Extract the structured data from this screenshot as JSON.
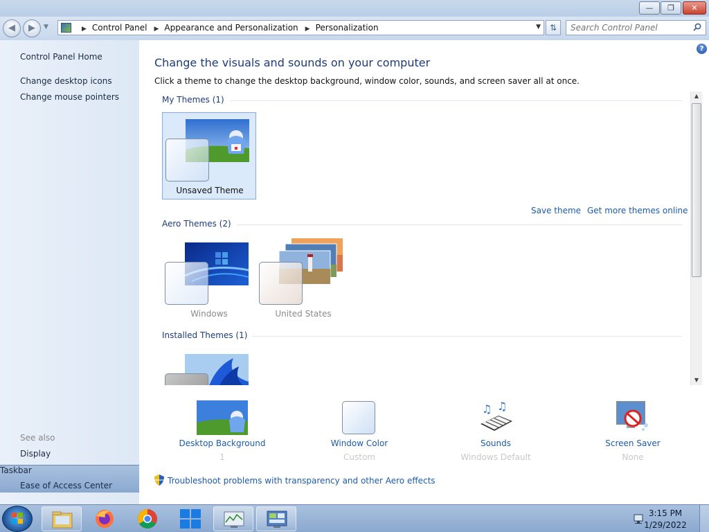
{
  "window": {
    "minimize_glyph": "—",
    "maximize_glyph": "❐",
    "close_glyph": "✕"
  },
  "address": {
    "crumbs": [
      "Control Panel",
      "Appearance and Personalization",
      "Personalization"
    ],
    "search_placeholder": "Search Control Panel"
  },
  "sidebar": {
    "home": "Control Panel Home",
    "links": [
      "Change desktop icons",
      "Change mouse pointers"
    ],
    "see_also_heading": "See also",
    "see_also": [
      "Display",
      "Taskbar",
      "Ease of Access Center"
    ]
  },
  "main": {
    "title": "Change the visuals and sounds on your computer",
    "subtitle": "Click a theme to change the desktop background, window color, sounds, and screen saver all at once.",
    "groups": {
      "my_themes": "My Themes (1)",
      "aero_themes": "Aero Themes (2)",
      "installed_themes": "Installed Themes (1)"
    },
    "themes": {
      "unsaved": "Unsaved Theme",
      "windows": "Windows",
      "united_states": "United States"
    },
    "save_theme": "Save theme",
    "get_more": "Get more themes online"
  },
  "settings": [
    {
      "label": "Desktop Background",
      "value": "1",
      "icon": "desktop-background-icon"
    },
    {
      "label": "Window Color",
      "value": "Custom",
      "icon": "window-color-icon"
    },
    {
      "label": "Sounds",
      "value": "Windows Default",
      "icon": "sounds-icon"
    },
    {
      "label": "Screen Saver",
      "value": "None",
      "icon": "screen-saver-icon"
    }
  ],
  "troubleshoot": "Troubleshoot problems with transparency and other Aero effects",
  "taskbar": {
    "time": "3:15 PM",
    "date": "1/29/2022",
    "apps": [
      "file-explorer-icon",
      "firefox-icon",
      "chrome-icon",
      "windows-11-icon",
      "performance-monitor-icon",
      "control-panel-icon"
    ]
  },
  "colors": {
    "link": "#1d5ba8",
    "heading": "#1e3b77",
    "selected_theme_bg": "#dbeafb"
  }
}
